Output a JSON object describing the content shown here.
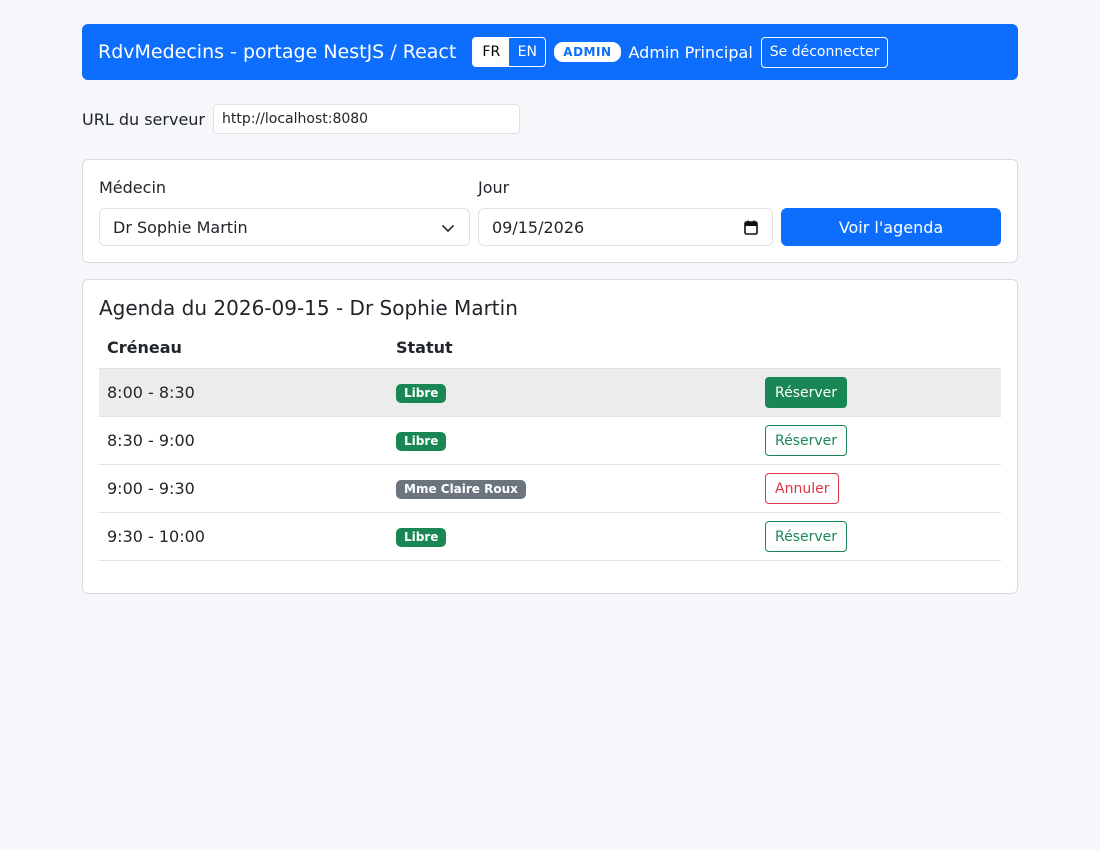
{
  "header": {
    "title": "RdvMedecins - portage NestJS / React",
    "languages": [
      {
        "label": "FR",
        "active": true
      },
      {
        "label": "EN",
        "active": false
      }
    ],
    "role_badge": "ADMIN",
    "user_name": "Admin Principal",
    "logout_label": "Se déconnecter"
  },
  "server": {
    "label": "URL du serveur",
    "value": "http://localhost:8080"
  },
  "form": {
    "doctor_label": "Médecin",
    "doctor_selected": "Dr Sophie Martin",
    "day_label": "Jour",
    "day_value": "09/15/2026",
    "submit_label": "Voir l'agenda"
  },
  "agenda": {
    "title": "Agenda du 2026-09-15 - Dr Sophie Martin",
    "columns": [
      "Créneau",
      "Statut",
      ""
    ],
    "rows": [
      {
        "slot": "8:00 - 8:30",
        "status": "Libre",
        "action": "Réserver"
      },
      {
        "slot": "8:30 - 9:00",
        "status": "Libre",
        "action": "Réserver"
      },
      {
        "slot": "9:00 - 9:30",
        "status": "Mme Claire Roux",
        "action": "Annuler"
      },
      {
        "slot": "9:30 - 10:00",
        "status": "Libre",
        "action": "Réserver"
      }
    ]
  },
  "colors": {
    "primary": "#0d6efd",
    "success": "#198754",
    "danger": "#dc3545",
    "secondary": "#6c757d"
  },
  "icons": {
    "select": "chevron-down-icon",
    "date": "calendar-icon"
  }
}
